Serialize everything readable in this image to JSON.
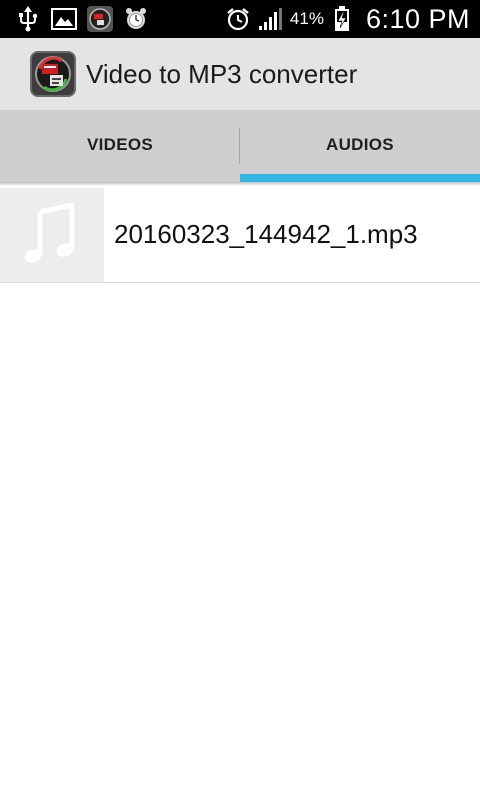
{
  "status_bar": {
    "left_icons": [
      "usb-icon",
      "image-icon",
      "app-notification-icon",
      "alarm-clock-notification-icon"
    ],
    "right_icons": [
      "alarm-icon",
      "signal-icon",
      "battery-charging-icon"
    ],
    "battery_percent": "41%",
    "time": "6:10 PM"
  },
  "action_bar": {
    "title": "Video to MP3 converter",
    "icon": "app-logo-icon"
  },
  "tabs": [
    {
      "label": "VIDEOS",
      "selected": false
    },
    {
      "label": "AUDIOS",
      "selected": true
    }
  ],
  "colors": {
    "tab_indicator": "#33b5e5",
    "action_bar_bg": "#e4e4e4",
    "tab_bar_bg": "#cfcfcf"
  },
  "audio_list": {
    "items": [
      {
        "file_name": "20160323_144942_1.mp3",
        "icon": "music-note-icon"
      }
    ]
  }
}
